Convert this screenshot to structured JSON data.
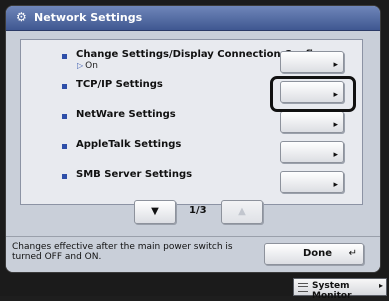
{
  "header": {
    "title": "Network Settings",
    "icon": "settings-icon"
  },
  "items": [
    {
      "label": "Change Settings/Display Connection Confirm.",
      "value": "On"
    },
    {
      "label": "TCP/IP Settings"
    },
    {
      "label": "NetWare Settings"
    },
    {
      "label": "AppleTalk Settings"
    },
    {
      "label": "SMB Server Settings"
    }
  ],
  "pager": {
    "page": "1/3"
  },
  "footer": {
    "message": "Changes effective after the main power switch is turned OFF and ON.",
    "done_label": "Done"
  },
  "system_monitor_label": "System Monitor",
  "colors": {
    "titlebar": "#4a619b",
    "bullet": "#2e4fa9",
    "panel": "#c9cfd9"
  }
}
